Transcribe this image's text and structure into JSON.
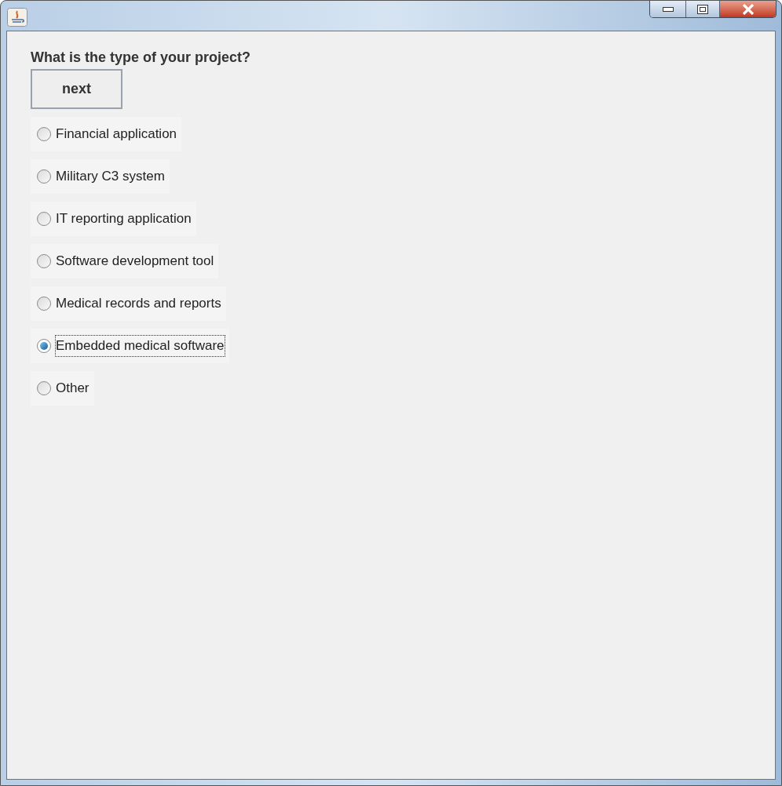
{
  "window": {
    "controls": [
      {
        "kind": "minimize"
      },
      {
        "kind": "maximize"
      },
      {
        "kind": "close"
      }
    ]
  },
  "question": "What is the type of your project?",
  "next_button": "next",
  "options": [
    {
      "label": "Financial application",
      "selected": false
    },
    {
      "label": "Military C3 system",
      "selected": false
    },
    {
      "label": "IT reporting application",
      "selected": false
    },
    {
      "label": "Software development tool",
      "selected": false
    },
    {
      "label": "Medical records and reports",
      "selected": false
    },
    {
      "label": "Embedded medical software",
      "selected": true
    },
    {
      "label": "Other",
      "selected": false
    }
  ]
}
